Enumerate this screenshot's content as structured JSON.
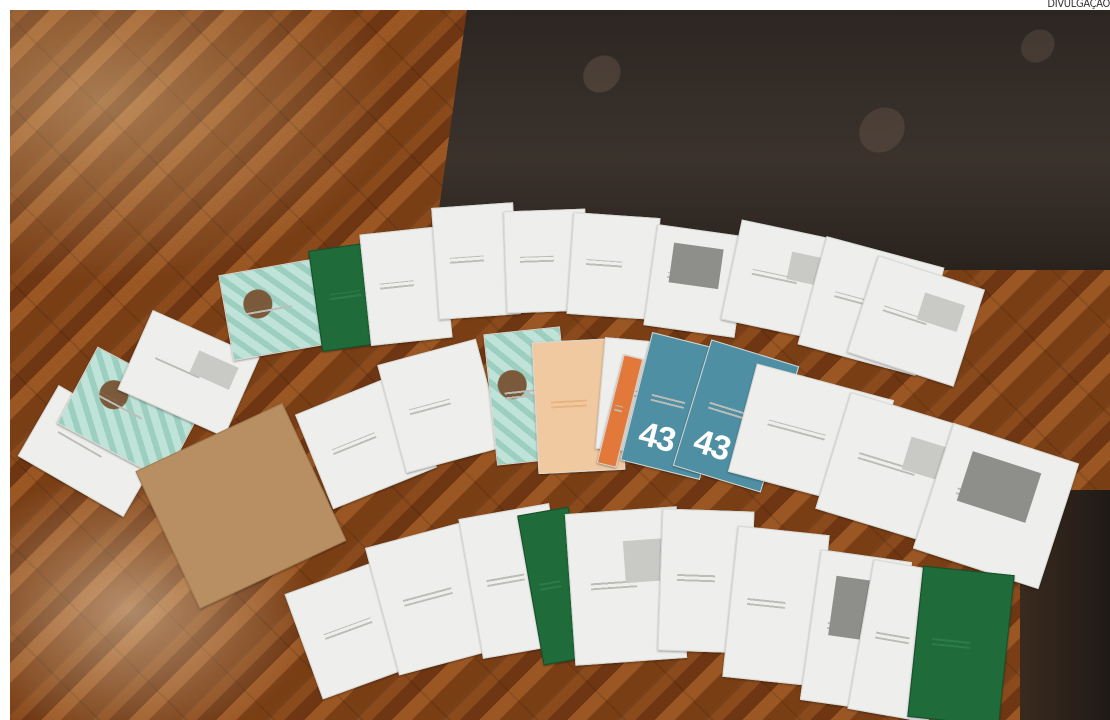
{
  "credit": "DIVULGAÇÃO",
  "photo": {
    "envelope_number_1": "43",
    "envelope_number_2": "43"
  },
  "colors": {
    "floor": "#7a3e15",
    "envelope": "#eeeeec",
    "green_envelope": "#1f6b3a",
    "kraft_envelope": "#b88f62",
    "sofa": "#3b322c"
  }
}
